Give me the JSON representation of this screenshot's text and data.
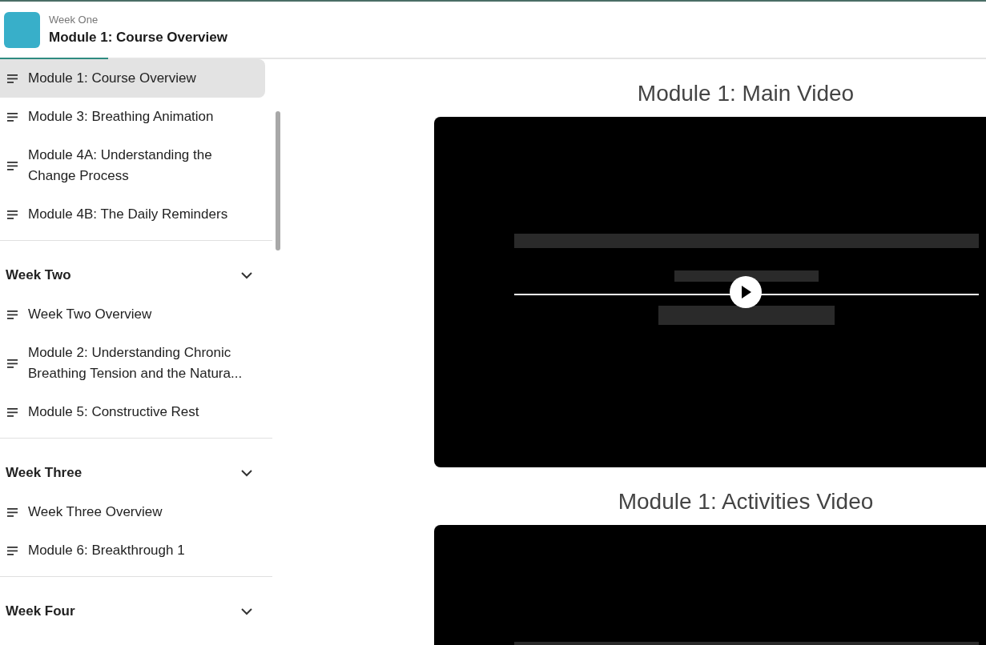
{
  "header": {
    "subtitle": "Week One",
    "title": "Module 1: Course Overview",
    "progress": {
      "level": 0.11
    }
  },
  "sidebar": {
    "sections": [
      {
        "items": [
          {
            "label": "Module 1: Course Overview",
            "selected": true
          },
          {
            "label": "Module 3: Breathing Animation",
            "selected": false
          },
          {
            "label": "Module 4A: Understanding the Change Process",
            "selected": false
          },
          {
            "label": "Module 4B: The Daily Reminders",
            "selected": false
          }
        ]
      },
      {
        "title": "Week Two",
        "expanded": true,
        "items": [
          {
            "label": "Week Two Overview",
            "selected": false
          },
          {
            "label": "Module 2: Understanding Chronic Breathing Tension and the Natura...",
            "selected": false
          },
          {
            "label": "Module 5: Constructive Rest",
            "selected": false
          }
        ]
      },
      {
        "title": "Week Three",
        "expanded": true,
        "items": [
          {
            "label": "Week Three Overview",
            "selected": false
          },
          {
            "label": "Module 6: Breakthrough 1",
            "selected": false
          }
        ]
      },
      {
        "title": "Week Four",
        "expanded": true
      }
    ]
  },
  "content": [
    {
      "title": "Module 1: Main Video",
      "video": {
        "kind": "player"
      }
    },
    {
      "title": "Module 1: Activities Video"
    }
  ]
}
